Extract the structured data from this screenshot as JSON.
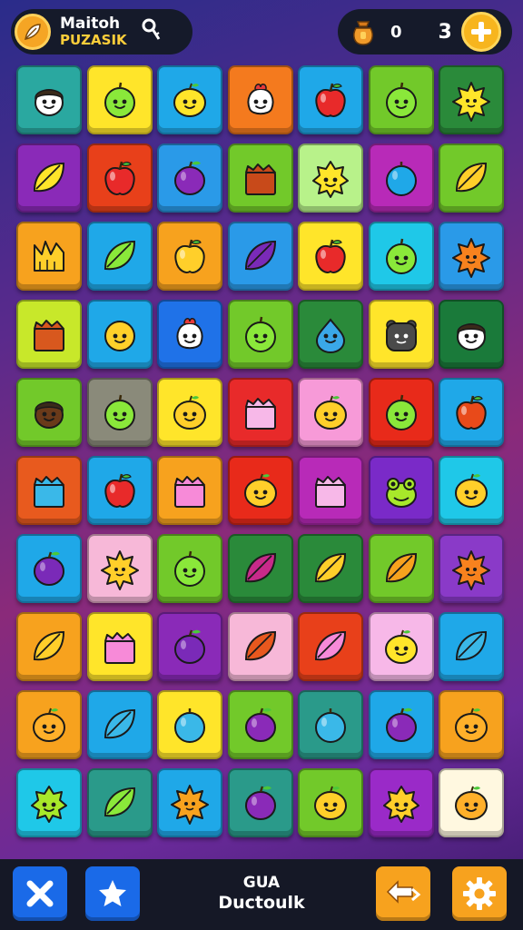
{
  "header": {
    "title_line1": "Maitoh",
    "title_line2": "PUZASIK",
    "counter_a": "0",
    "counter_b": "3",
    "logo_icon": "leaf-icon",
    "search_icon": "key-icon",
    "coin_icon": "bag-icon",
    "add_icon": "plus-icon"
  },
  "board": {
    "rows": 10,
    "cols": 7,
    "tiles": [
      [
        "face-boy",
        "fruit-pear",
        "fruit-lemon",
        "face-radish",
        "fruit-apple",
        "fruit-pear",
        "star-fruit"
      ],
      [
        "fruit-leaf",
        "fruit-apple",
        "fruit-plum",
        "box",
        "star-face",
        "fruit-round",
        "fruit-leaf"
      ],
      [
        "crown",
        "fruit-leaf",
        "fruit-apple",
        "fruit-leaf",
        "fruit-apple",
        "fruit-pear",
        "star-fruit"
      ],
      [
        "box",
        "fruit-smile",
        "face-radish",
        "fruit-pear",
        "fruit-drop",
        "face-bear",
        "face-boy"
      ],
      [
        "face-boy",
        "fruit-pear",
        "fruit-lemon",
        "box",
        "fruit-lemon",
        "fruit-pear",
        "fruit-apple"
      ],
      [
        "box",
        "fruit-apple",
        "box",
        "fruit-lemon",
        "box",
        "face-frog",
        "fruit-lemon"
      ],
      [
        "fruit-plum",
        "star-fruit",
        "fruit-pear",
        "fruit-leaf",
        "fruit-leaf",
        "fruit-leaf",
        "star-fruit"
      ],
      [
        "fruit-leaf",
        "box",
        "fruit-plum",
        "fruit-leaf",
        "fruit-leaf",
        "fruit-lemon",
        "fruit-leaf"
      ],
      [
        "fruit-lemon",
        "fruit-leaf",
        "fruit-round",
        "fruit-plum",
        "fruit-round",
        "fruit-plum",
        "fruit-lemon"
      ],
      [
        "star-face",
        "fruit-leaf",
        "star-fruit",
        "fruit-plum",
        "fruit-lemon",
        "star-face",
        "fruit-lemon"
      ]
    ],
    "tile_colors": [
      [
        "#2aa8a0",
        "#ffe52a",
        "#1fa8e8",
        "#f47a1e",
        "#1fa8e8",
        "#72c92a",
        "#2a8a3a"
      ],
      [
        "#8a2ab8",
        "#e8401a",
        "#2a9ae8",
        "#72c92a",
        "#b8f28a",
        "#b82ab8",
        "#72c92a"
      ],
      [
        "#f7a21e",
        "#1fa8e8",
        "#f7a21e",
        "#2a9ae8",
        "#ffe52a",
        "#1fc8e8",
        "#2a9ae8"
      ],
      [
        "#c8e82a",
        "#1fa8e8",
        "#1f72e8",
        "#72c92a",
        "#2a8a3a",
        "#ffe52a",
        "#1a7a3a"
      ],
      [
        "#72c92a",
        "#8a8a7a",
        "#ffe52a",
        "#e82a2a",
        "#f79ad8",
        "#e82a1a",
        "#1fa8e8"
      ],
      [
        "#e85a1e",
        "#1fa8e8",
        "#f7a21e",
        "#e82a1a",
        "#b82ab8",
        "#7a2ac8",
        "#1fc8e8"
      ],
      [
        "#1fa8e8",
        "#f7b8d8",
        "#72c92a",
        "#2a8a3a",
        "#2a8a3a",
        "#72c92a",
        "#8a3ac8"
      ],
      [
        "#f7a21e",
        "#ffe52a",
        "#8a2ab8",
        "#f7b8d8",
        "#e8401a",
        "#f7b8e8",
        "#1fa8e8"
      ],
      [
        "#f7a21e",
        "#1fa8e8",
        "#ffe52a",
        "#72c92a",
        "#2a9a8a",
        "#1fa8e8",
        "#f7a21e"
      ],
      [
        "#1fc8e8",
        "#2a9a8a",
        "#1fa8e8",
        "#2a9a8a",
        "#72c92a",
        "#9a2ac8",
        "#fff8e0"
      ]
    ],
    "icon_colors": [
      [
        "#ffffff",
        "#8ae83a",
        "#ffe52a",
        "#ffffff",
        "#e82a2a",
        "#8ae83a",
        "#ffe52a"
      ],
      [
        "#ffe52a",
        "#e82a2a",
        "#8a2ab8",
        "#c84a1a",
        "#ffe52a",
        "#1fa8e8",
        "#ffcf2a"
      ],
      [
        "#ffcf2a",
        "#8ae83a",
        "#ffcf2a",
        "#7a2ab8",
        "#e82a2a",
        "#8ae83a",
        "#f7821e"
      ],
      [
        "#d8581e",
        "#ffd02a",
        "#ffffff",
        "#8ae83a",
        "#3aa8e8",
        "#4a4a4a",
        "#ffffff"
      ],
      [
        "#6a3a1a",
        "#8ae83a",
        "#ffcf2a",
        "#f7b8e8",
        "#ffcf2a",
        "#8ae83a",
        "#e84a1a"
      ],
      [
        "#3ab8e8",
        "#e82a2a",
        "#f78ad8",
        "#ffcf2a",
        "#f7b8e8",
        "#a8e82a",
        "#ffcf2a"
      ],
      [
        "#7a2ab8",
        "#ffcf2a",
        "#8ae83a",
        "#c82a8a",
        "#ffcf2a",
        "#f7a21e",
        "#f7821e"
      ],
      [
        "#ffcf2a",
        "#f78ad8",
        "#7a2ab8",
        "#e8581e",
        "#f78ad8",
        "#ffe52a",
        "#3ab8e8"
      ],
      [
        "#ffb02a",
        "#3ab8e8",
        "#3ab8e8",
        "#8a2ab8",
        "#3ab8e8",
        "#8a2ab8",
        "#ffb02a"
      ],
      [
        "#a8e82a",
        "#8ae83a",
        "#f7a21e",
        "#8a2ab8",
        "#ffcf2a",
        "#ffcf2a",
        "#ffb02a"
      ]
    ]
  },
  "footer": {
    "label_line1": "GUA",
    "label_line2": "Ductoulk",
    "close_icon": "close-icon",
    "star_icon": "star-icon",
    "swap_icon": "swap-arrow-icon",
    "settings_icon": "gear-icon"
  },
  "colors": {
    "topbar_pill": "#151a2a",
    "accent_orange": "#f7a21e",
    "accent_yellow": "#ffcf3a",
    "footer_bg": "#151826",
    "footer_blue": "#1a6ae8"
  }
}
